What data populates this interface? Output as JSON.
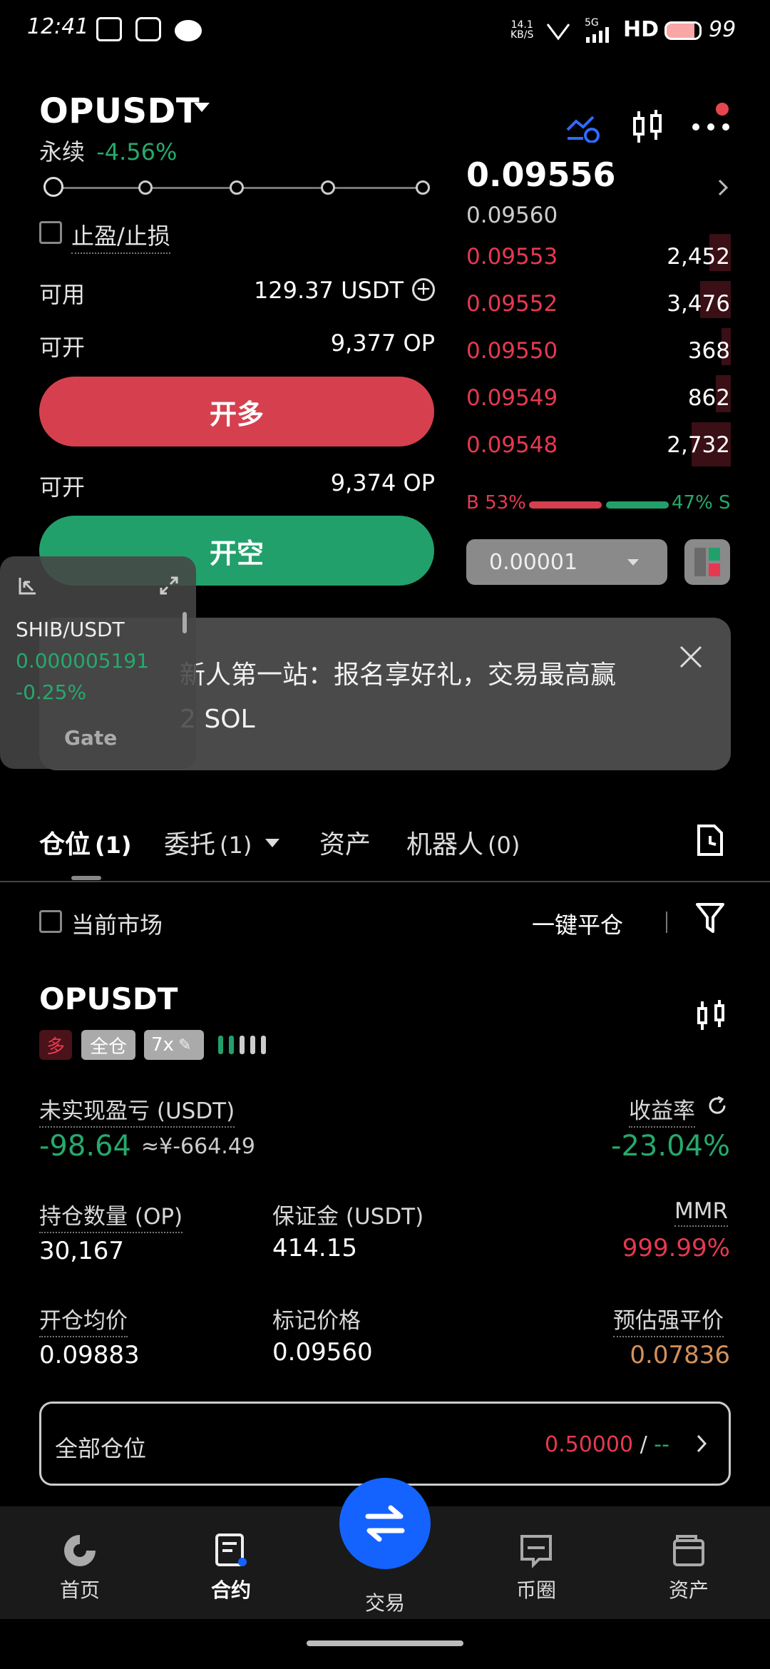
{
  "status_bar": {
    "time": "12:41",
    "net_speed_top": "14.1",
    "net_speed_unit": "KB/S",
    "network": "5G",
    "hd": "HD",
    "battery": "99"
  },
  "header": {
    "pair": "OPUSDT",
    "contract_type": "永续",
    "change_pct": "-4.56%"
  },
  "order_form": {
    "tp_sl_label": "止盈/止损",
    "available_label": "可用",
    "available_value": "129.37 USDT",
    "can_open_label_1": "可开",
    "can_open_value_1": "9,377 OP",
    "long_button": "开多",
    "can_open_label_2": "可开",
    "can_open_value_2": "9,374 OP",
    "short_button": "开空"
  },
  "orderbook": {
    "last_price": "0.09556",
    "mark_price": "0.09560",
    "asks": [
      {
        "price": "0.09553",
        "qty": "2,452"
      },
      {
        "price": "0.09552",
        "qty": "3,476"
      },
      {
        "price": "0.09550",
        "qty": "368"
      },
      {
        "price": "0.09549",
        "qty": "862"
      },
      {
        "price": "0.09548",
        "qty": "2,732"
      }
    ],
    "buy_ratio": "B 53%",
    "sell_ratio": "47% S",
    "tick_size": "0.00001"
  },
  "floating_ticker": {
    "pair": "SHIB/USDT",
    "price": "0.000005191",
    "change": "-0.25%",
    "brand": "Gate"
  },
  "banner": {
    "text_line1": "新人第一站：报名享好礼，交易最高赢",
    "text_line2": "2 SOL"
  },
  "tabs": {
    "positions": "仓位",
    "positions_count": "(1)",
    "orders": "委托",
    "orders_count": "(1)",
    "assets": "资产",
    "bots": "机器人",
    "bots_count": "(0)"
  },
  "filter_row": {
    "current_market": "当前市场",
    "close_all": "一键平仓"
  },
  "position": {
    "pair": "OPUSDT",
    "side_tag": "多",
    "margin_mode_tag": "全仓",
    "leverage_tag": "7x",
    "unrealized_pnl_label": "未实现盈亏 (USDT)",
    "unrealized_pnl_value": "-98.64",
    "unrealized_pnl_cny": "≈¥-664.49",
    "roe_label": "收益率",
    "roe_value": "-23.04%",
    "size_label": "持仓数量 (OP)",
    "size_value": "30,167",
    "margin_label": "保证金 (USDT)",
    "margin_value": "414.15",
    "mmr_label": "MMR",
    "mmr_value": "999.99%",
    "entry_price_label": "开仓均价",
    "entry_price_value": "0.09883",
    "mark_price_label": "标记价格",
    "mark_price_value": "0.09560",
    "liq_price_label": "预估强平价",
    "liq_price_value": "0.07836"
  },
  "all_positions": {
    "label": "全部仓位",
    "value_red": "0.50000",
    "separator": "/",
    "value_green": "--"
  },
  "bottom_nav": {
    "home": "首页",
    "futures": "合约",
    "trade": "交易",
    "moments": "币圈",
    "assets": "资产"
  },
  "colors": {
    "green": "#26a96c",
    "red": "#e63950",
    "blue": "#1463ff",
    "liq_orange": "#d4915a"
  }
}
